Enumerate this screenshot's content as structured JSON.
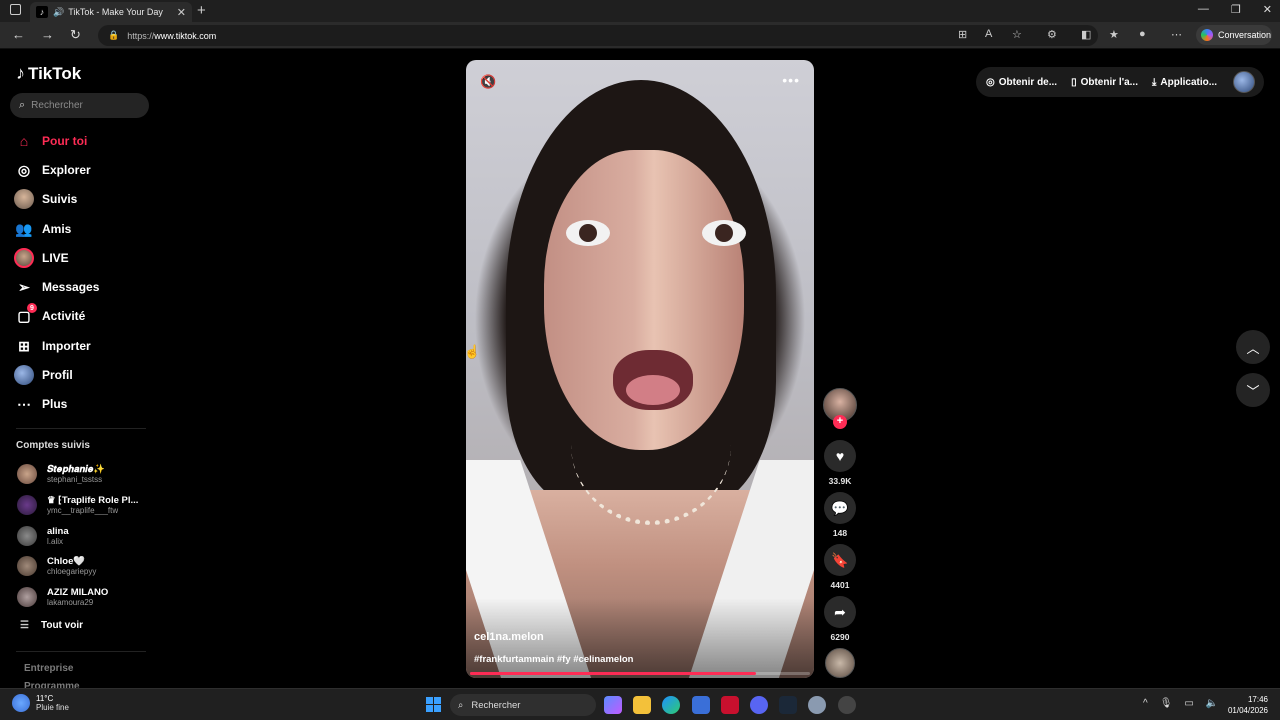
{
  "browser": {
    "tab_title": "TikTok - Make Your Day",
    "url_scheme": "https://",
    "url_host": "www.tiktok.com",
    "conversation_label": "Conversation"
  },
  "app": {
    "logo_text": "TikTok",
    "search_placeholder": "Rechercher",
    "accent_color": "#fe2c55"
  },
  "nav": [
    {
      "label": "Pour toi",
      "icon": "home-icon",
      "active": true
    },
    {
      "label": "Explorer",
      "icon": "compass-icon"
    },
    {
      "label": "Suivis",
      "icon": "following-avatar"
    },
    {
      "label": "Amis",
      "icon": "friends-icon"
    },
    {
      "label": "LIVE",
      "icon": "live-avatar"
    },
    {
      "label": "Messages",
      "icon": "send-icon"
    },
    {
      "label": "Activité",
      "icon": "activity-icon",
      "badge": "9"
    },
    {
      "label": "Importer",
      "icon": "upload-icon"
    },
    {
      "label": "Profil",
      "icon": "profile-avatar"
    },
    {
      "label": "Plus",
      "icon": "more-icon"
    }
  ],
  "followed": {
    "title": "Comptes suivis",
    "accounts": [
      {
        "name": "𝑺𝒕𝒆𝒑𝒉𝒂𝒏𝒊𝒆✨",
        "handle": "stephani_tsstss"
      },
      {
        "name": "♛ ⁅Traplife Role Pl...",
        "handle": "ymc__traplife___ftw"
      },
      {
        "name": "alina",
        "handle": "l.alix"
      },
      {
        "name": "Chloe🤍",
        "handle": "chloegariepyy"
      },
      {
        "name": "AZIZ MILANO",
        "handle": "lakamoura29"
      }
    ],
    "see_all": "Tout voir"
  },
  "footer": {
    "line1": "Entreprise",
    "line2": "Programme"
  },
  "video": {
    "username": "cel1na.melon",
    "hashtags": "#frankfurtammain #fy #celinamelon",
    "progress": 0.84
  },
  "actions": {
    "likes": "33.9K",
    "comments": "148",
    "saves": "4401",
    "shares": "6290"
  },
  "top_buttons": {
    "b1": "Obtenir de...",
    "b2": "Obtenir l'a...",
    "b3": "Applicatio..."
  },
  "taskbar": {
    "temp": "11°C",
    "weather": "Pluie fine",
    "search": "Rechercher",
    "time": "17:46",
    "date": "01/04/2026"
  }
}
